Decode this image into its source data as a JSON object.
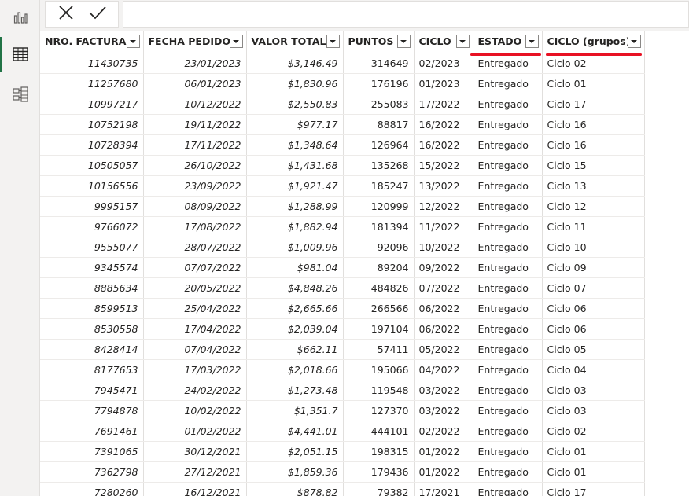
{
  "rail": {
    "items": [
      {
        "name": "report-view-icon",
        "active": false
      },
      {
        "name": "data-view-icon",
        "active": true
      },
      {
        "name": "model-view-icon",
        "active": false
      }
    ]
  },
  "formula_bar": {
    "cancel_icon": "close-icon",
    "commit_icon": "check-icon",
    "value": ""
  },
  "table": {
    "columns": [
      {
        "label": "NRO. FACTURA",
        "align": "num",
        "highlight": false
      },
      {
        "label": "FECHA PEDIDO",
        "align": "num",
        "highlight": false
      },
      {
        "label": "VALOR TOTAL",
        "align": "num",
        "highlight": false
      },
      {
        "label": "PUNTOS",
        "align": "plain",
        "highlight": false
      },
      {
        "label": "CICLO",
        "align": "txt",
        "highlight": false
      },
      {
        "label": "ESTADO",
        "align": "txt",
        "highlight": true
      },
      {
        "label": "CICLO (grupos)",
        "align": "txt",
        "highlight": true
      }
    ],
    "rows": [
      [
        "11430735",
        "23/01/2023",
        "$3,146.49",
        "314649",
        "02/2023",
        "Entregado",
        "Ciclo 02"
      ],
      [
        "11257680",
        "06/01/2023",
        "$1,830.96",
        "176196",
        "01/2023",
        "Entregado",
        "Ciclo 01"
      ],
      [
        "10997217",
        "10/12/2022",
        "$2,550.83",
        "255083",
        "17/2022",
        "Entregado",
        "Ciclo 17"
      ],
      [
        "10752198",
        "19/11/2022",
        "$977.17",
        "88817",
        "16/2022",
        "Entregado",
        "Ciclo 16"
      ],
      [
        "10728394",
        "17/11/2022",
        "$1,348.64",
        "126964",
        "16/2022",
        "Entregado",
        "Ciclo 16"
      ],
      [
        "10505057",
        "26/10/2022",
        "$1,431.68",
        "135268",
        "15/2022",
        "Entregado",
        "Ciclo 15"
      ],
      [
        "10156556",
        "23/09/2022",
        "$1,921.47",
        "185247",
        "13/2022",
        "Entregado",
        "Ciclo 13"
      ],
      [
        "9995157",
        "08/09/2022",
        "$1,288.99",
        "120999",
        "12/2022",
        "Entregado",
        "Ciclo 12"
      ],
      [
        "9766072",
        "17/08/2022",
        "$1,882.94",
        "181394",
        "11/2022",
        "Entregado",
        "Ciclo 11"
      ],
      [
        "9555077",
        "28/07/2022",
        "$1,009.96",
        "92096",
        "10/2022",
        "Entregado",
        "Ciclo 10"
      ],
      [
        "9345574",
        "07/07/2022",
        "$981.04",
        "89204",
        "09/2022",
        "Entregado",
        "Ciclo 09"
      ],
      [
        "8885634",
        "20/05/2022",
        "$4,848.26",
        "484826",
        "07/2022",
        "Entregado",
        "Ciclo 07"
      ],
      [
        "8599513",
        "25/04/2022",
        "$2,665.66",
        "266566",
        "06/2022",
        "Entregado",
        "Ciclo 06"
      ],
      [
        "8530558",
        "17/04/2022",
        "$2,039.04",
        "197104",
        "06/2022",
        "Entregado",
        "Ciclo 06"
      ],
      [
        "8428414",
        "07/04/2022",
        "$662.11",
        "57411",
        "05/2022",
        "Entregado",
        "Ciclo 05"
      ],
      [
        "8177653",
        "17/03/2022",
        "$2,018.66",
        "195066",
        "04/2022",
        "Entregado",
        "Ciclo 04"
      ],
      [
        "7945471",
        "24/02/2022",
        "$1,273.48",
        "119548",
        "03/2022",
        "Entregado",
        "Ciclo 03"
      ],
      [
        "7794878",
        "10/02/2022",
        "$1,351.7",
        "127370",
        "03/2022",
        "Entregado",
        "Ciclo 03"
      ],
      [
        "7691461",
        "01/02/2022",
        "$4,441.01",
        "444101",
        "02/2022",
        "Entregado",
        "Ciclo 02"
      ],
      [
        "7391065",
        "30/12/2021",
        "$2,051.15",
        "198315",
        "01/2022",
        "Entregado",
        "Ciclo 01"
      ],
      [
        "7362798",
        "27/12/2021",
        "$1,859.36",
        "179436",
        "01/2022",
        "Entregado",
        "Ciclo 01"
      ],
      [
        "7280260",
        "16/12/2021",
        "$878.82",
        "79382",
        "17/2021",
        "Entregado",
        "Ciclo 17"
      ]
    ]
  },
  "colors": {
    "accent": "#217346",
    "annotation_underline": "#e81123"
  }
}
